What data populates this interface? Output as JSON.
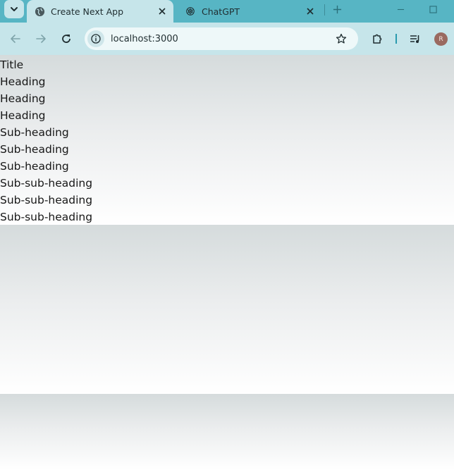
{
  "browser": {
    "tabs": [
      {
        "title": "Create Next App",
        "favicon": "globe-icon",
        "active": true
      },
      {
        "title": "ChatGPT",
        "favicon": "chatgpt-logo-icon",
        "active": false
      }
    ],
    "url": "localhost:3000",
    "profile_initial": "R",
    "colors": {
      "tabstrip": "#57b5c4",
      "toolbar": "#c6e5ea",
      "omnibox": "#eef8f9"
    }
  },
  "page": {
    "lines": [
      "Title",
      "Heading",
      "Heading",
      "Heading",
      "Sub-heading",
      "Sub-heading",
      "Sub-heading",
      "Sub-sub-heading",
      "Sub-sub-heading",
      "Sub-sub-heading"
    ]
  }
}
